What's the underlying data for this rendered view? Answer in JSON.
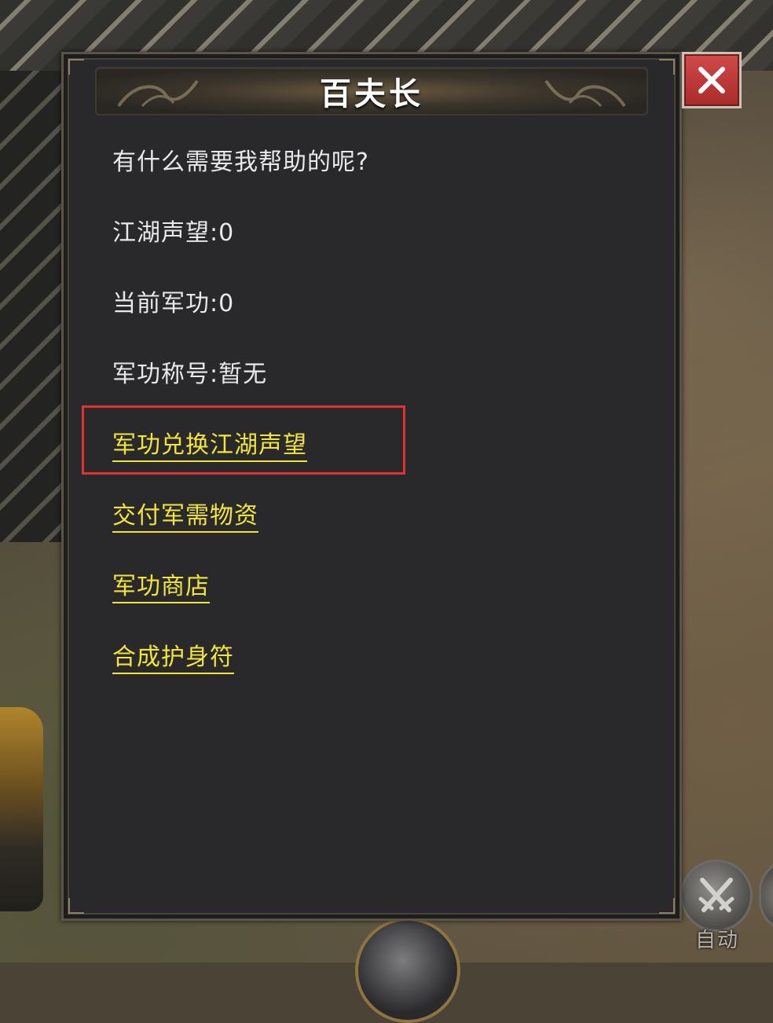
{
  "dialog": {
    "title": "百夫长",
    "greeting": "有什么需要我帮助的呢?",
    "stats": {
      "reputation": "江湖声望:0",
      "merit": "当前军功:0",
      "merit_title": "军功称号:暂无"
    },
    "options": [
      {
        "label": "军功兑换江湖声望",
        "highlighted": true
      },
      {
        "label": "交付军需物资",
        "highlighted": false
      },
      {
        "label": "军功商店",
        "highlighted": false
      },
      {
        "label": "合成护身符",
        "highlighted": false
      }
    ],
    "close_icon": "close-icon"
  },
  "hud": {
    "auto_label": "自动",
    "auto_icon": "crossed-swords-icon"
  },
  "colors": {
    "panel_bg": "#29292b",
    "text": "#e9e9e9",
    "link": "#f2e53a",
    "highlight": "#e03232",
    "close_button": "#c23a3a"
  }
}
